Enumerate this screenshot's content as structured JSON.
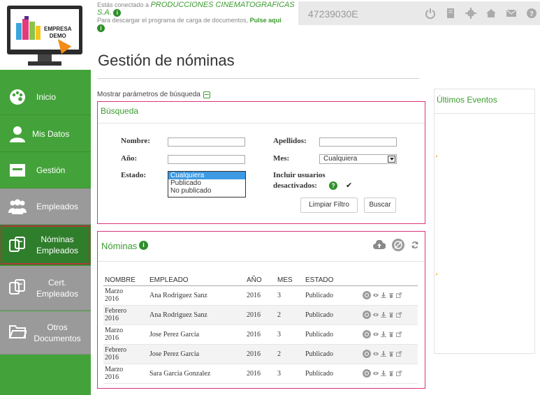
{
  "brand": {
    "logo_line1": "EMPRESA",
    "logo_line2": "DEMO",
    "colors": {
      "green": "#43a33a",
      "dark_green": "#2f7e2c",
      "gray": "#9a9a9a",
      "accent_pink": "#d8347a",
      "orange": "#f28c16"
    }
  },
  "sidebar": {
    "items": [
      {
        "label": "Inicio",
        "icon": "palette-icon"
      },
      {
        "label": "Mis Datos",
        "icon": "user-icon"
      },
      {
        "label": "Gestión",
        "icon": "monitor-icon"
      },
      {
        "label": "Empleados",
        "icon": "users-icon"
      },
      {
        "label": "Nóminas Empleados",
        "icon": "documents-icon"
      },
      {
        "label": "Cert. Empleados",
        "icon": "documents-icon"
      },
      {
        "label": "Otros Documentos",
        "icon": "folder-icon"
      }
    ]
  },
  "topbar": {
    "connected_prefix": "Estás conectado a ",
    "company": "PRODUCCIONES CINEMATOGRAFICAS S.A.",
    "download_text": "Para descargar el programa de carga de documentos, ",
    "download_link": "Pulse aquí",
    "user_id": "47239030E",
    "icons": [
      "power-icon",
      "book-icon",
      "gear-icon",
      "home-icon",
      "mail-icon",
      "help-icon"
    ]
  },
  "page": {
    "title": "Gestión de nóminas",
    "show_params": "Mostrar parámetros de búsqueda"
  },
  "search": {
    "title": "Búsqueda",
    "nombre_label": "Nombre:",
    "nombre_value": "",
    "apellidos_label": "Apellidos:",
    "apellidos_value": "",
    "anio_label": "Año:",
    "anio_value": "",
    "mes_label": "Mes:",
    "mes_value": "Cualquiera",
    "estado_label": "Estado:",
    "estado_options": [
      "Cualquiera",
      "Publicado",
      "No publicado"
    ],
    "estado_selected": "Cualquiera",
    "incluir_label_1": "Incluir usuarios",
    "incluir_label_2": "desactivados:",
    "incluir_checked": "✔",
    "clear_button": "Limpiar Filtro",
    "search_button": "Buscar"
  },
  "nominas": {
    "title": "Nóminas",
    "columns": [
      "NOMBRE",
      "EMPLEADO",
      "AÑO",
      "MES",
      "ESTADO"
    ],
    "rows": [
      {
        "nombre": "Marzo 2016",
        "empleado": "Ana Rodriguez Sanz",
        "anio": "2016",
        "mes": "3",
        "estado": "Publicado"
      },
      {
        "nombre": "Febrero 2016",
        "empleado": "Ana Rodriguez Sanz",
        "anio": "2016",
        "mes": "2",
        "estado": "Publicado"
      },
      {
        "nombre": "Marzo 2016",
        "empleado": "Jose Perez Garcia",
        "anio": "2016",
        "mes": "3",
        "estado": "Publicado"
      },
      {
        "nombre": "Febrero 2016",
        "empleado": "Jose Perez Garcia",
        "anio": "2016",
        "mes": "2",
        "estado": "Publicado"
      },
      {
        "nombre": "Marzo 2016",
        "empleado": "Sara Garcia Gonzalez",
        "anio": "2016",
        "mes": "3",
        "estado": "Publicado"
      }
    ]
  },
  "events": {
    "title": "Últimos Eventos"
  }
}
